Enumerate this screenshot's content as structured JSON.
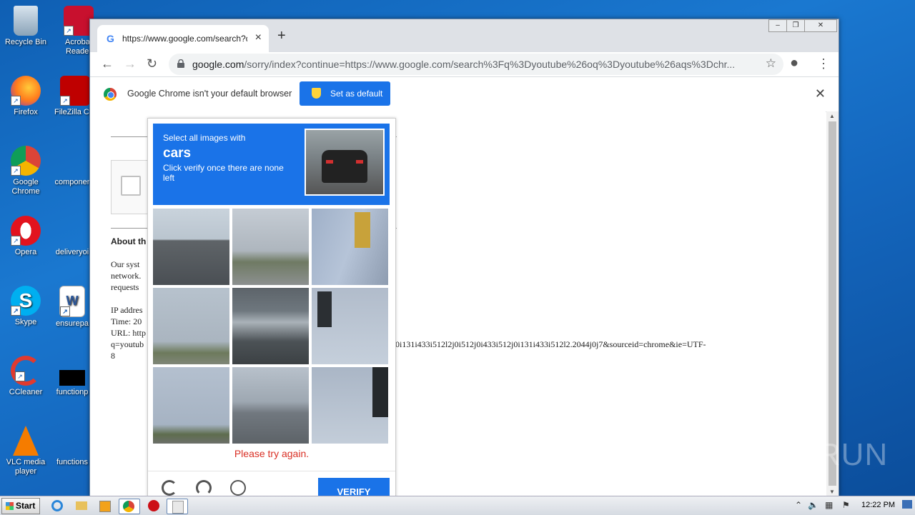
{
  "desktop": {
    "icons": [
      {
        "label": "Recycle Bin",
        "icon": "recycle-bin-icon"
      },
      {
        "label": "Acrobat Reader",
        "icon": "acrobat-reader-icon"
      },
      {
        "label": "Firefox",
        "icon": "firefox-icon"
      },
      {
        "label": "FileZilla C...",
        "icon": "filezilla-icon"
      },
      {
        "label": "Google Chrome",
        "icon": "chrome-icon"
      },
      {
        "label": "componer",
        "icon": "file-icon"
      },
      {
        "label": "Opera",
        "icon": "opera-icon"
      },
      {
        "label": "deliveryoi",
        "icon": "file-icon"
      },
      {
        "label": "Skype",
        "icon": "skype-icon"
      },
      {
        "label": "ensurepa",
        "icon": "word-doc-icon"
      },
      {
        "label": "CCleaner",
        "icon": "ccleaner-icon"
      },
      {
        "label": "functionp",
        "icon": "file-icon"
      },
      {
        "label": "VLC media player",
        "icon": "vlc-icon"
      },
      {
        "label": "functions",
        "icon": "file-icon"
      }
    ]
  },
  "browser": {
    "tab_title": "https://www.google.com/search?q=",
    "url_domain": "google.com",
    "url_rest": "/sorry/index?continue=https://www.google.com/search%3Fq%3Dyoutube%26oq%3Dyoutube%26aqs%3Dchr...",
    "infobar_message": "Google Chrome isn't your default browser",
    "set_default_label": "Set as default"
  },
  "page": {
    "heading": "About th",
    "para_line1": "Our syst",
    "para_line2": "network.",
    "para_line3": "requests",
    "ip_line": "IP addres",
    "time_line": "Time: 20",
    "url_line": "URL: http",
    "q_line": "q=youtub",
    "q_line_tail": "0i131i433i512l2j0i512j0i433i512j0i131i433i512l2.2044j0j7&sourceid=chrome&ie=UTF-",
    "last_line": "8"
  },
  "captcha": {
    "instruction": "Select all images with",
    "target": "cars",
    "hint": "Click verify once there are none left",
    "error": "Please try again.",
    "verify_label": "VERIFY",
    "tiles": [
      "highway",
      "traffic-light-poles",
      "traffic-light",
      "pole-field",
      "overpass",
      "traffic-light",
      "palm-trees",
      "street-cars",
      "traffic-light"
    ]
  },
  "taskbar": {
    "start_label": "Start",
    "clock": "12:22 PM"
  },
  "watermark": "ANY RUN",
  "colors": {
    "accent": "#1a73e8",
    "error": "#d93025"
  }
}
